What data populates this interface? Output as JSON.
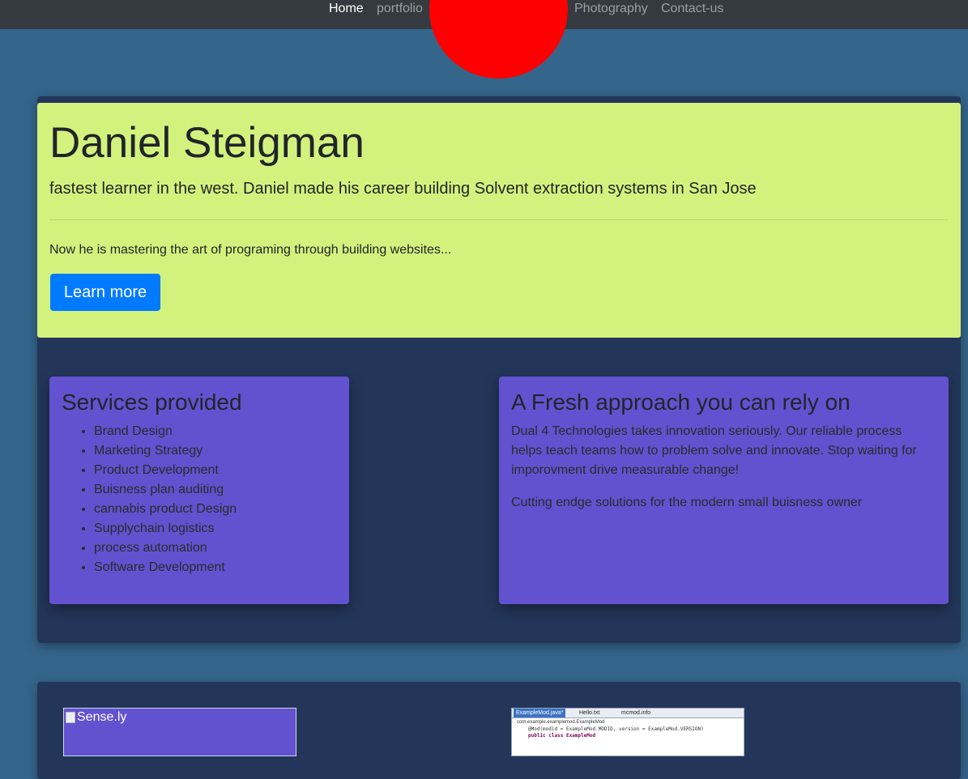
{
  "nav": {
    "items": [
      {
        "label": "Home",
        "active": true
      },
      {
        "label": "portfolio",
        "active": false
      },
      {
        "label": "Photography",
        "active": false
      },
      {
        "label": "Contact-us",
        "active": false
      }
    ]
  },
  "hero": {
    "title": "Daniel Steigman",
    "lead": "fastest learner in the west. Daniel made his career building Solvent extraction systems in San Jose",
    "text": "Now he is mastering the art of programing through building websites...",
    "button_label": "Learn more"
  },
  "services": {
    "title": "Services provided",
    "items": [
      "Brand Design",
      "Marketing Strategy",
      "Product Development",
      "Buisness plan auditing",
      "cannabis product Design",
      "Supplychain logistics",
      "process automation",
      "Software Development"
    ]
  },
  "approach": {
    "title": "A Fresh approach you can rely on",
    "paragraph1": "Dual 4 Technologies takes innovation seriously. Our reliable process helps teach teams how to problem solve and innovate. Stop waiting for imporovment drive measurable change!",
    "paragraph2": "Cutting endge solutions for the modern small buisness owner"
  },
  "portfolio": {
    "image1_alt": "Sense.ly",
    "code_tabs": [
      "ExampleMod.java*",
      "Hello.txt",
      "mcmod.info"
    ],
    "code_path": "com.example.examplemod.ExampleMod",
    "code_lines": [
      "@Mod(modid = ExampleMod.MODID, version = ExampleMod.VERSION)",
      "public class ExampleMod"
    ]
  },
  "colors": {
    "page_bg": "#35658b",
    "navbar_bg": "#343a40",
    "logo_circle": "#ff0000",
    "section_bg": "#23365a",
    "jumbotron_bg": "#d3f27d",
    "card_bg": "#6252d0",
    "button_bg": "#007bff"
  }
}
